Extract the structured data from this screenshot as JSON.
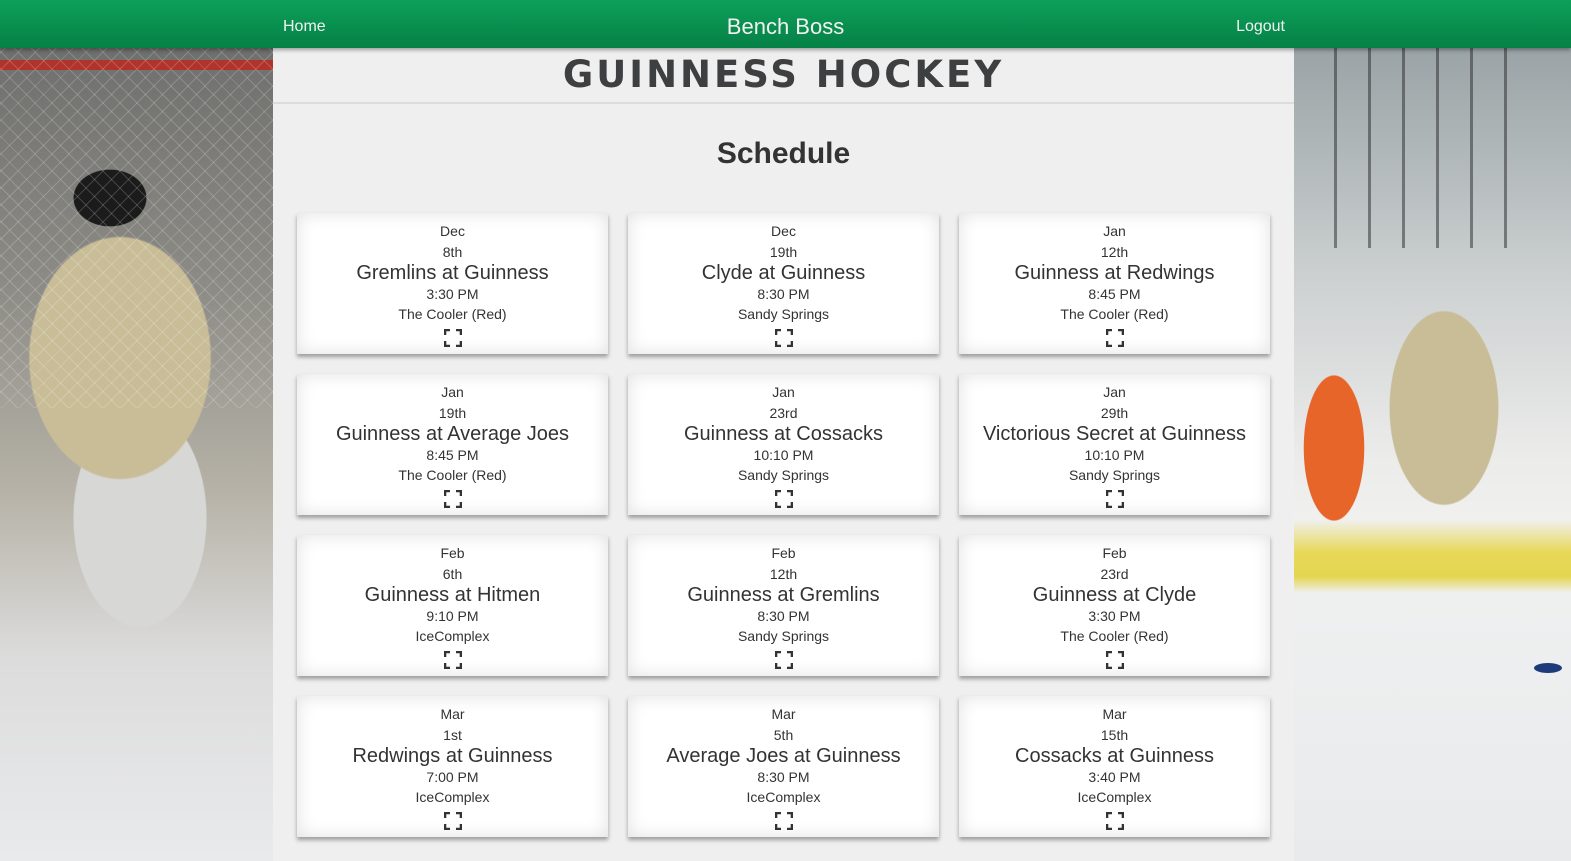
{
  "nav": {
    "home": "Home",
    "title": "Bench Boss",
    "logout": "Logout"
  },
  "team": {
    "name": "GUINNESS HOCKEY"
  },
  "page": {
    "title": "Schedule"
  },
  "games": [
    {
      "month": "Dec",
      "day": "8th",
      "matchup": "Gremlins at Guinness",
      "time": "3:30 PM",
      "venue": "The Cooler (Red)"
    },
    {
      "month": "Dec",
      "day": "19th",
      "matchup": "Clyde at Guinness",
      "time": "8:30 PM",
      "venue": "Sandy Springs"
    },
    {
      "month": "Jan",
      "day": "12th",
      "matchup": "Guinness at Redwings",
      "time": "8:45 PM",
      "venue": "The Cooler (Red)"
    },
    {
      "month": "Jan",
      "day": "19th",
      "matchup": "Guinness at Average Joes",
      "time": "8:45 PM",
      "venue": "The Cooler (Red)"
    },
    {
      "month": "Jan",
      "day": "23rd",
      "matchup": "Guinness at Cossacks",
      "time": "10:10 PM",
      "venue": "Sandy Springs"
    },
    {
      "month": "Jan",
      "day": "29th",
      "matchup": "Victorious Secret at Guinness",
      "time": "10:10 PM",
      "venue": "Sandy Springs"
    },
    {
      "month": "Feb",
      "day": "6th",
      "matchup": "Guinness at Hitmen",
      "time": "9:10 PM",
      "venue": "IceComplex"
    },
    {
      "month": "Feb",
      "day": "12th",
      "matchup": "Guinness at Gremlins",
      "time": "8:30 PM",
      "venue": "Sandy Springs"
    },
    {
      "month": "Feb",
      "day": "23rd",
      "matchup": "Guinness at Clyde",
      "time": "3:30 PM",
      "venue": "The Cooler (Red)"
    },
    {
      "month": "Mar",
      "day": "1st",
      "matchup": "Redwings at Guinness",
      "time": "7:00 PM",
      "venue": "IceComplex"
    },
    {
      "month": "Mar",
      "day": "5th",
      "matchup": "Average Joes at Guinness",
      "time": "8:30 PM",
      "venue": "IceComplex"
    },
    {
      "month": "Mar",
      "day": "15th",
      "matchup": "Cossacks at Guinness",
      "time": "3:40 PM",
      "venue": "IceComplex"
    }
  ],
  "icons": {
    "expand": "fullscreen-expand-icon"
  },
  "colors": {
    "navbar": "#058146",
    "navbar_light": "#0da05a",
    "nav_text": "#f2f2f2",
    "title_text": "#3d3f41"
  }
}
